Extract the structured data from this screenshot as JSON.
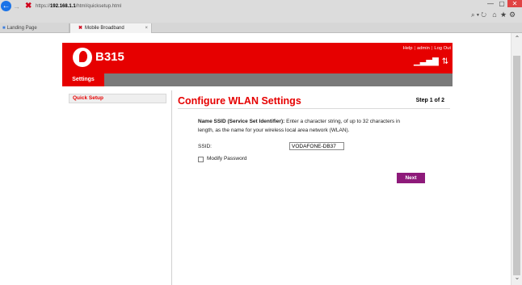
{
  "browser": {
    "address": "https://192.168.1.1/html/quicksetup.html",
    "address_prefix": "https://",
    "address_host": "192.168.1.1",
    "address_path": "/html/quicksetup.html",
    "tabs": [
      {
        "label": "Landing Page",
        "active": false
      },
      {
        "label": "Mobile Broadband",
        "active": true
      }
    ],
    "search_refresh": "⌕ ▾ ↻",
    "icons": {
      "home": "home-icon",
      "star": "star-icon",
      "gear": "gear-icon"
    },
    "window": {
      "minimize": "—",
      "maximize": "▢",
      "close": "✕"
    }
  },
  "header": {
    "product": "B315",
    "links": {
      "help": "Help",
      "admin": "admin",
      "logout": "Log Out"
    },
    "brand_color": "#e60000"
  },
  "nav": {
    "active": "Settings"
  },
  "sidebar": {
    "items": [
      {
        "label": "Quick Setup",
        "active": true
      }
    ]
  },
  "main": {
    "title": "Configure WLAN Settings",
    "step": "Step 1 of 2",
    "desc_bold": "Name SSID (Service Set Identifier):",
    "desc_rest": " Enter a character string, of up to 32 characters in",
    "desc_line2": "length, as the name for your wireless local area network (WLAN).",
    "ssid_label": "SSID:",
    "ssid_value": "VODAFONE-DB37",
    "modify_password_label": "Modify Password",
    "modify_password_checked": false,
    "next_label": "Next",
    "next_color": "#8e1a7a"
  }
}
